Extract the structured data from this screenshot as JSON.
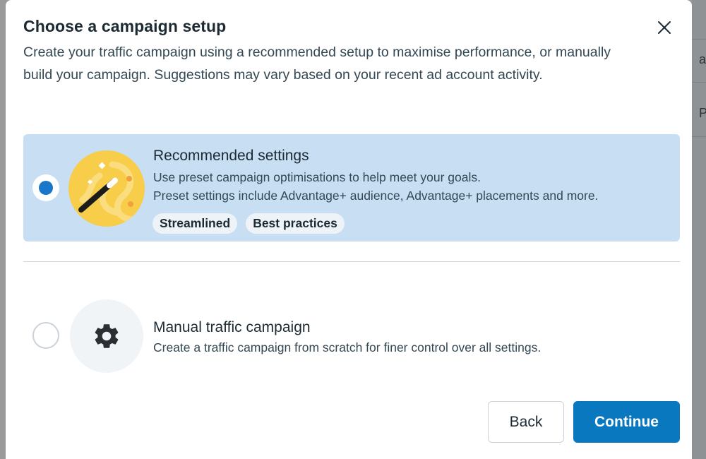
{
  "dialog": {
    "title": "Choose a campaign setup",
    "subtitle": "Create your traffic campaign using a recommended setup to maximise performance, or manually build your campaign. Suggestions may vary based on your recent ad account activity.",
    "close_icon": "close-icon"
  },
  "options": [
    {
      "title": "Recommended settings",
      "description_lines": [
        "Use preset campaign optimisations to help meet your goals.",
        "Preset settings include Advantage+ audience, Advantage+ placements and more."
      ],
      "tags": [
        "Streamlined",
        "Best practices"
      ],
      "selected": true,
      "icon": "magic-wand-icon"
    },
    {
      "title": "Manual traffic campaign",
      "description_lines": [
        "Create a traffic campaign from scratch for finer control over all settings."
      ],
      "selected": false,
      "icon": "gear-icon"
    }
  ],
  "buttons": {
    "back_label": "Back",
    "continue_label": "Continue"
  },
  "background": {
    "partial_text_1": "a",
    "partial_text_2": "P"
  },
  "colors": {
    "selected_bg": "#c7def3",
    "accent": "#0a78be",
    "radio_dot": "#1877c9",
    "wand_circle": "#f7cd4a"
  }
}
